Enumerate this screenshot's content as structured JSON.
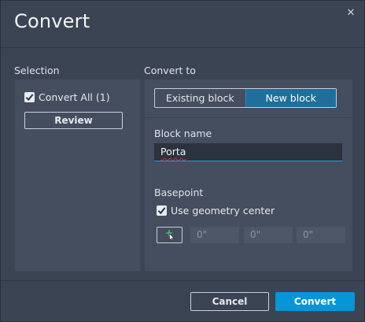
{
  "dialog": {
    "title": "Convert",
    "close_glyph": "✕"
  },
  "selection": {
    "heading": "Selection",
    "convert_all": {
      "label": "Convert All (1)",
      "checked": true
    },
    "review_label": "Review"
  },
  "convert_to": {
    "heading": "Convert to",
    "options": [
      {
        "label": "Existing block",
        "active": false
      },
      {
        "label": "New block",
        "active": true
      }
    ],
    "block_name": {
      "label": "Block name",
      "value": "Porta"
    },
    "basepoint": {
      "label": "Basepoint",
      "use_geometry_center": {
        "label": "Use geometry center",
        "checked": true
      },
      "pick_icon": "pick-point-icon",
      "coords": [
        {
          "placeholder": "0\""
        },
        {
          "placeholder": "0\""
        },
        {
          "placeholder": "0\""
        }
      ]
    }
  },
  "footer": {
    "cancel_label": "Cancel",
    "convert_label": "Convert"
  },
  "colors": {
    "accent": "#0696d7",
    "active_tab": "#1e6f9c",
    "panel": "#454e5e",
    "background": "#3b4453"
  }
}
